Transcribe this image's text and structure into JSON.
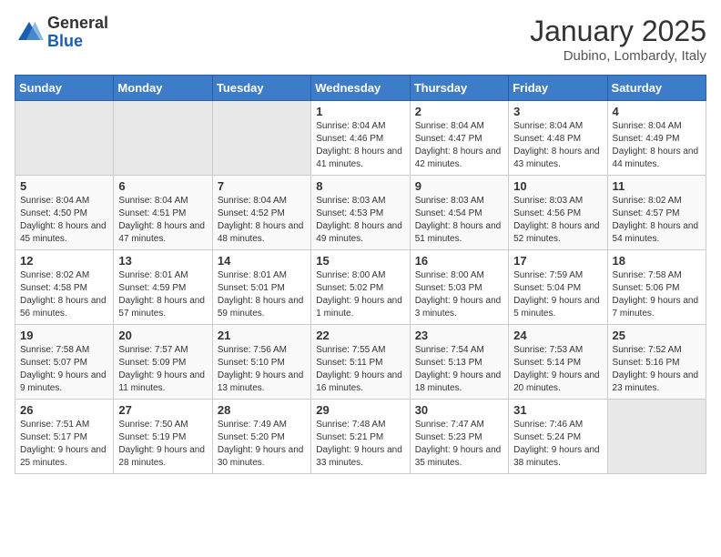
{
  "header": {
    "logo_general": "General",
    "logo_blue": "Blue",
    "month_title": "January 2025",
    "location": "Dubino, Lombardy, Italy"
  },
  "days_of_week": [
    "Sunday",
    "Monday",
    "Tuesday",
    "Wednesday",
    "Thursday",
    "Friday",
    "Saturday"
  ],
  "weeks": [
    [
      {
        "day": "",
        "empty": true
      },
      {
        "day": "",
        "empty": true
      },
      {
        "day": "",
        "empty": true
      },
      {
        "day": "1",
        "sunrise": "8:04 AM",
        "sunset": "4:46 PM",
        "daylight": "8 hours and 41 minutes."
      },
      {
        "day": "2",
        "sunrise": "8:04 AM",
        "sunset": "4:47 PM",
        "daylight": "8 hours and 42 minutes."
      },
      {
        "day": "3",
        "sunrise": "8:04 AM",
        "sunset": "4:48 PM",
        "daylight": "8 hours and 43 minutes."
      },
      {
        "day": "4",
        "sunrise": "8:04 AM",
        "sunset": "4:49 PM",
        "daylight": "8 hours and 44 minutes."
      }
    ],
    [
      {
        "day": "5",
        "sunrise": "8:04 AM",
        "sunset": "4:50 PM",
        "daylight": "8 hours and 45 minutes."
      },
      {
        "day": "6",
        "sunrise": "8:04 AM",
        "sunset": "4:51 PM",
        "daylight": "8 hours and 47 minutes."
      },
      {
        "day": "7",
        "sunrise": "8:04 AM",
        "sunset": "4:52 PM",
        "daylight": "8 hours and 48 minutes."
      },
      {
        "day": "8",
        "sunrise": "8:03 AM",
        "sunset": "4:53 PM",
        "daylight": "8 hours and 49 minutes."
      },
      {
        "day": "9",
        "sunrise": "8:03 AM",
        "sunset": "4:54 PM",
        "daylight": "8 hours and 51 minutes."
      },
      {
        "day": "10",
        "sunrise": "8:03 AM",
        "sunset": "4:56 PM",
        "daylight": "8 hours and 52 minutes."
      },
      {
        "day": "11",
        "sunrise": "8:02 AM",
        "sunset": "4:57 PM",
        "daylight": "8 hours and 54 minutes."
      }
    ],
    [
      {
        "day": "12",
        "sunrise": "8:02 AM",
        "sunset": "4:58 PM",
        "daylight": "8 hours and 56 minutes."
      },
      {
        "day": "13",
        "sunrise": "8:01 AM",
        "sunset": "4:59 PM",
        "daylight": "8 hours and 57 minutes."
      },
      {
        "day": "14",
        "sunrise": "8:01 AM",
        "sunset": "5:01 PM",
        "daylight": "8 hours and 59 minutes."
      },
      {
        "day": "15",
        "sunrise": "8:00 AM",
        "sunset": "5:02 PM",
        "daylight": "9 hours and 1 minute."
      },
      {
        "day": "16",
        "sunrise": "8:00 AM",
        "sunset": "5:03 PM",
        "daylight": "9 hours and 3 minutes."
      },
      {
        "day": "17",
        "sunrise": "7:59 AM",
        "sunset": "5:04 PM",
        "daylight": "9 hours and 5 minutes."
      },
      {
        "day": "18",
        "sunrise": "7:58 AM",
        "sunset": "5:06 PM",
        "daylight": "9 hours and 7 minutes."
      }
    ],
    [
      {
        "day": "19",
        "sunrise": "7:58 AM",
        "sunset": "5:07 PM",
        "daylight": "9 hours and 9 minutes."
      },
      {
        "day": "20",
        "sunrise": "7:57 AM",
        "sunset": "5:09 PM",
        "daylight": "9 hours and 11 minutes."
      },
      {
        "day": "21",
        "sunrise": "7:56 AM",
        "sunset": "5:10 PM",
        "daylight": "9 hours and 13 minutes."
      },
      {
        "day": "22",
        "sunrise": "7:55 AM",
        "sunset": "5:11 PM",
        "daylight": "9 hours and 16 minutes."
      },
      {
        "day": "23",
        "sunrise": "7:54 AM",
        "sunset": "5:13 PM",
        "daylight": "9 hours and 18 minutes."
      },
      {
        "day": "24",
        "sunrise": "7:53 AM",
        "sunset": "5:14 PM",
        "daylight": "9 hours and 20 minutes."
      },
      {
        "day": "25",
        "sunrise": "7:52 AM",
        "sunset": "5:16 PM",
        "daylight": "9 hours and 23 minutes."
      }
    ],
    [
      {
        "day": "26",
        "sunrise": "7:51 AM",
        "sunset": "5:17 PM",
        "daylight": "9 hours and 25 minutes."
      },
      {
        "day": "27",
        "sunrise": "7:50 AM",
        "sunset": "5:19 PM",
        "daylight": "9 hours and 28 minutes."
      },
      {
        "day": "28",
        "sunrise": "7:49 AM",
        "sunset": "5:20 PM",
        "daylight": "9 hours and 30 minutes."
      },
      {
        "day": "29",
        "sunrise": "7:48 AM",
        "sunset": "5:21 PM",
        "daylight": "9 hours and 33 minutes."
      },
      {
        "day": "30",
        "sunrise": "7:47 AM",
        "sunset": "5:23 PM",
        "daylight": "9 hours and 35 minutes."
      },
      {
        "day": "31",
        "sunrise": "7:46 AM",
        "sunset": "5:24 PM",
        "daylight": "9 hours and 38 minutes."
      },
      {
        "day": "",
        "empty": true
      }
    ]
  ]
}
